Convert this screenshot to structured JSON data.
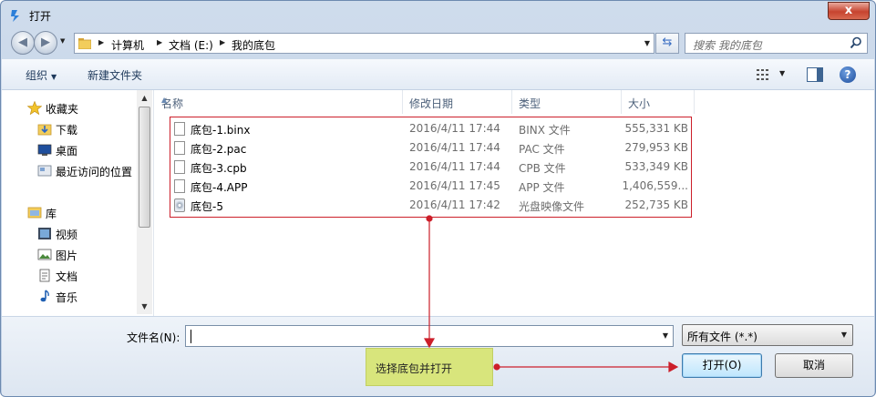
{
  "window": {
    "title": "打开",
    "close_label": "x"
  },
  "address": {
    "breadcrumbs": [
      "计算机",
      "文档 (E:)",
      "我的底包"
    ],
    "search_placeholder": "搜索 我的底包"
  },
  "toolbar": {
    "organize_label": "组织",
    "new_folder_label": "新建文件夹"
  },
  "sidebar": {
    "favorites_label": "收藏夹",
    "favorites": [
      "下载",
      "桌面",
      "最近访问的位置"
    ],
    "libraries_label": "库",
    "libraries": [
      "视频",
      "图片",
      "文档",
      "音乐"
    ]
  },
  "columns": [
    "名称",
    "修改日期",
    "类型",
    "大小"
  ],
  "files": [
    {
      "name": "底包-1.binx",
      "date": "2016/4/11 17:44",
      "type": "BINX 文件",
      "size": "555,331 KB",
      "icon": "file-icon"
    },
    {
      "name": "底包-2.pac",
      "date": "2016/4/11 17:44",
      "type": "PAC 文件",
      "size": "279,953 KB",
      "icon": "file-icon"
    },
    {
      "name": "底包-3.cpb",
      "date": "2016/4/11 17:44",
      "type": "CPB 文件",
      "size": "533,349 KB",
      "icon": "file-icon"
    },
    {
      "name": "底包-4.APP",
      "date": "2016/4/11 17:45",
      "type": "APP 文件",
      "size": "1,406,559...",
      "icon": "file-icon"
    },
    {
      "name": "底包-5",
      "date": "2016/4/11 17:42",
      "type": "光盘映像文件",
      "size": "252,735 KB",
      "icon": "disc-image-icon"
    }
  ],
  "footer": {
    "filename_label": "文件名(N):",
    "filename_value": "",
    "filetype_value": "所有文件 (*.*)",
    "open_label": "打开(O)",
    "cancel_label": "取消"
  },
  "annotation": {
    "callout_text": "选择底包并打开",
    "color": "#cc1f2a"
  },
  "colors": {
    "accent": "#3d7bad",
    "highlight": "#cc1f2a",
    "callout_bg": "#d8e57c"
  }
}
